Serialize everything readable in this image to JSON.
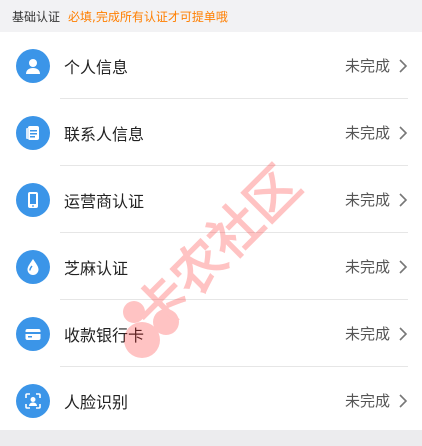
{
  "section": {
    "title": "基础认证",
    "note": "必填,完成所有认证才可提单哦"
  },
  "items": [
    {
      "label": "个人信息",
      "status": "未完成",
      "icon": "person-icon"
    },
    {
      "label": "联系人信息",
      "status": "未完成",
      "icon": "contact-card-icon"
    },
    {
      "label": "运营商认证",
      "status": "未完成",
      "icon": "phone-icon"
    },
    {
      "label": "芝麻认证",
      "status": "未完成",
      "icon": "sesame-drop-icon"
    },
    {
      "label": "收款银行卡",
      "status": "未完成",
      "icon": "bank-card-icon"
    },
    {
      "label": "人脸识别",
      "status": "未完成",
      "icon": "face-scan-icon"
    }
  ],
  "watermark": {
    "text": "卡农社区"
  },
  "colors": {
    "accent": "#3b95e8",
    "note": "#ff7f00",
    "watermark": "#ff2a2a"
  }
}
